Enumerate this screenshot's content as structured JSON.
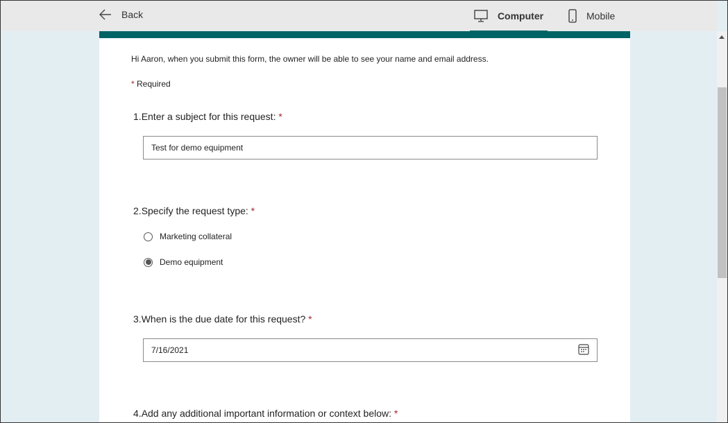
{
  "header": {
    "back_label": "Back",
    "tabs": [
      {
        "label": "Computer",
        "active": true,
        "icon": "monitor-icon"
      },
      {
        "label": "Mobile",
        "active": false,
        "icon": "phone-icon"
      }
    ]
  },
  "colors": {
    "accent": "#006466",
    "required": "#a4262c",
    "background": "#e3eef3"
  },
  "form": {
    "intro": "Hi Aaron, when you submit this form, the owner will be able to see your name and email address.",
    "required_note": "Required",
    "required_mark": "*",
    "questions": [
      {
        "number": "1.",
        "text": "Enter a subject for this request:",
        "value": "Test for demo equipment"
      },
      {
        "number": "2.",
        "text": "Specify the request type:",
        "options": [
          {
            "label": "Marketing collateral",
            "selected": false
          },
          {
            "label": "Demo equipment",
            "selected": true
          }
        ]
      },
      {
        "number": "3.",
        "text": "When is the due date for this request?",
        "value": "7/16/2021"
      },
      {
        "number": "4.",
        "text": "Add any additional important information or context below:"
      }
    ]
  }
}
